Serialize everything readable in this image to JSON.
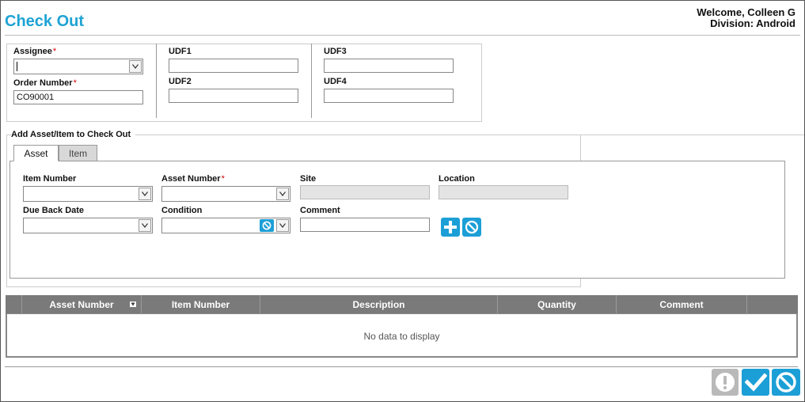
{
  "header": {
    "title": "Check Out",
    "welcome": "Welcome, Colleen G",
    "division": "Division: Android"
  },
  "order": {
    "assignee_label": "Assignee",
    "order_number_label": "Order Number",
    "order_number_value": "CO90001",
    "udf1_label": "UDF1",
    "udf2_label": "UDF2",
    "udf3_label": "UDF3",
    "udf4_label": "UDF4",
    "required_mark": "*"
  },
  "add_section": {
    "legend": "Add Asset/Item to Check Out",
    "tabs": [
      "Asset",
      "Item"
    ],
    "item_number_label": "Item Number",
    "asset_number_label": "Asset Number",
    "site_label": "Site",
    "location_label": "Location",
    "due_back_label": "Due Back Date",
    "condition_label": "Condition",
    "comment_label": "Comment"
  },
  "grid": {
    "columns": [
      "Asset Number",
      "Item Number",
      "Description",
      "Quantity",
      "Comment"
    ],
    "empty_text": "No data to display"
  },
  "colors": {
    "accent": "#1c9fd6",
    "title": "#1fa3d4",
    "grid_header": "#7a7a7a",
    "disabled_button": "#b9b9b9"
  },
  "icons": {
    "add": "plus-icon",
    "clear": "cancel-circle-icon",
    "warning": "exclamation-icon",
    "confirm": "checkmark-icon",
    "cancel": "cancel-circle-icon"
  }
}
